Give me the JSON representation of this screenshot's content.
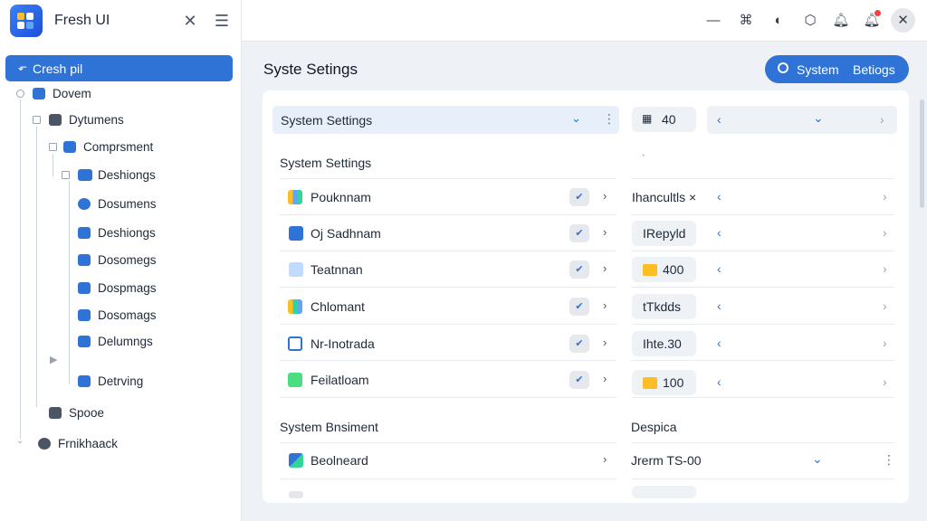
{
  "app": {
    "title": "Fresh UI"
  },
  "sidebar": {
    "selected": "Cresh pil",
    "items": [
      {
        "label": "Dovem"
      },
      {
        "label": "Dytumens"
      },
      {
        "label": "Comprsment"
      },
      {
        "label": "Deshiongs"
      },
      {
        "label": "Dosumens"
      },
      {
        "label": "Deshiongs"
      },
      {
        "label": "Dosomegs"
      },
      {
        "label": "Dospmags"
      },
      {
        "label": "Dosomags"
      },
      {
        "label": "Delumngs"
      },
      {
        "label": "Detrving"
      },
      {
        "label": "Spooe"
      },
      {
        "label": "Frnikhaack"
      }
    ]
  },
  "header": {
    "page_title": "Syste Setings",
    "system_button": {
      "left": "System",
      "right": "Betiogs"
    }
  },
  "main": {
    "selector_label": "System Settings",
    "grid_count": "40",
    "section1_title": "System Settings",
    "small_mark": "`",
    "rows": [
      {
        "label": "Pouknnam",
        "value": "Ihancultls ×"
      },
      {
        "label": "Oj Sadhnam",
        "value": "IRepyld"
      },
      {
        "label": "Teatnnan",
        "value": "400"
      },
      {
        "label": "Chlomant",
        "value": "tTkdds"
      },
      {
        "label": "Nr-Inotrada",
        "value": "Ihte.30"
      },
      {
        "label": "Feilatloam",
        "value": "100"
      }
    ],
    "section2_title": "System Bnsiment",
    "section2_right_title": "Despica",
    "row2": {
      "label": "Beolneard",
      "value": "Jrerm TS-00"
    }
  },
  "colors": {
    "accent": "#2f73d6",
    "selected_bg": "#e7effa"
  }
}
